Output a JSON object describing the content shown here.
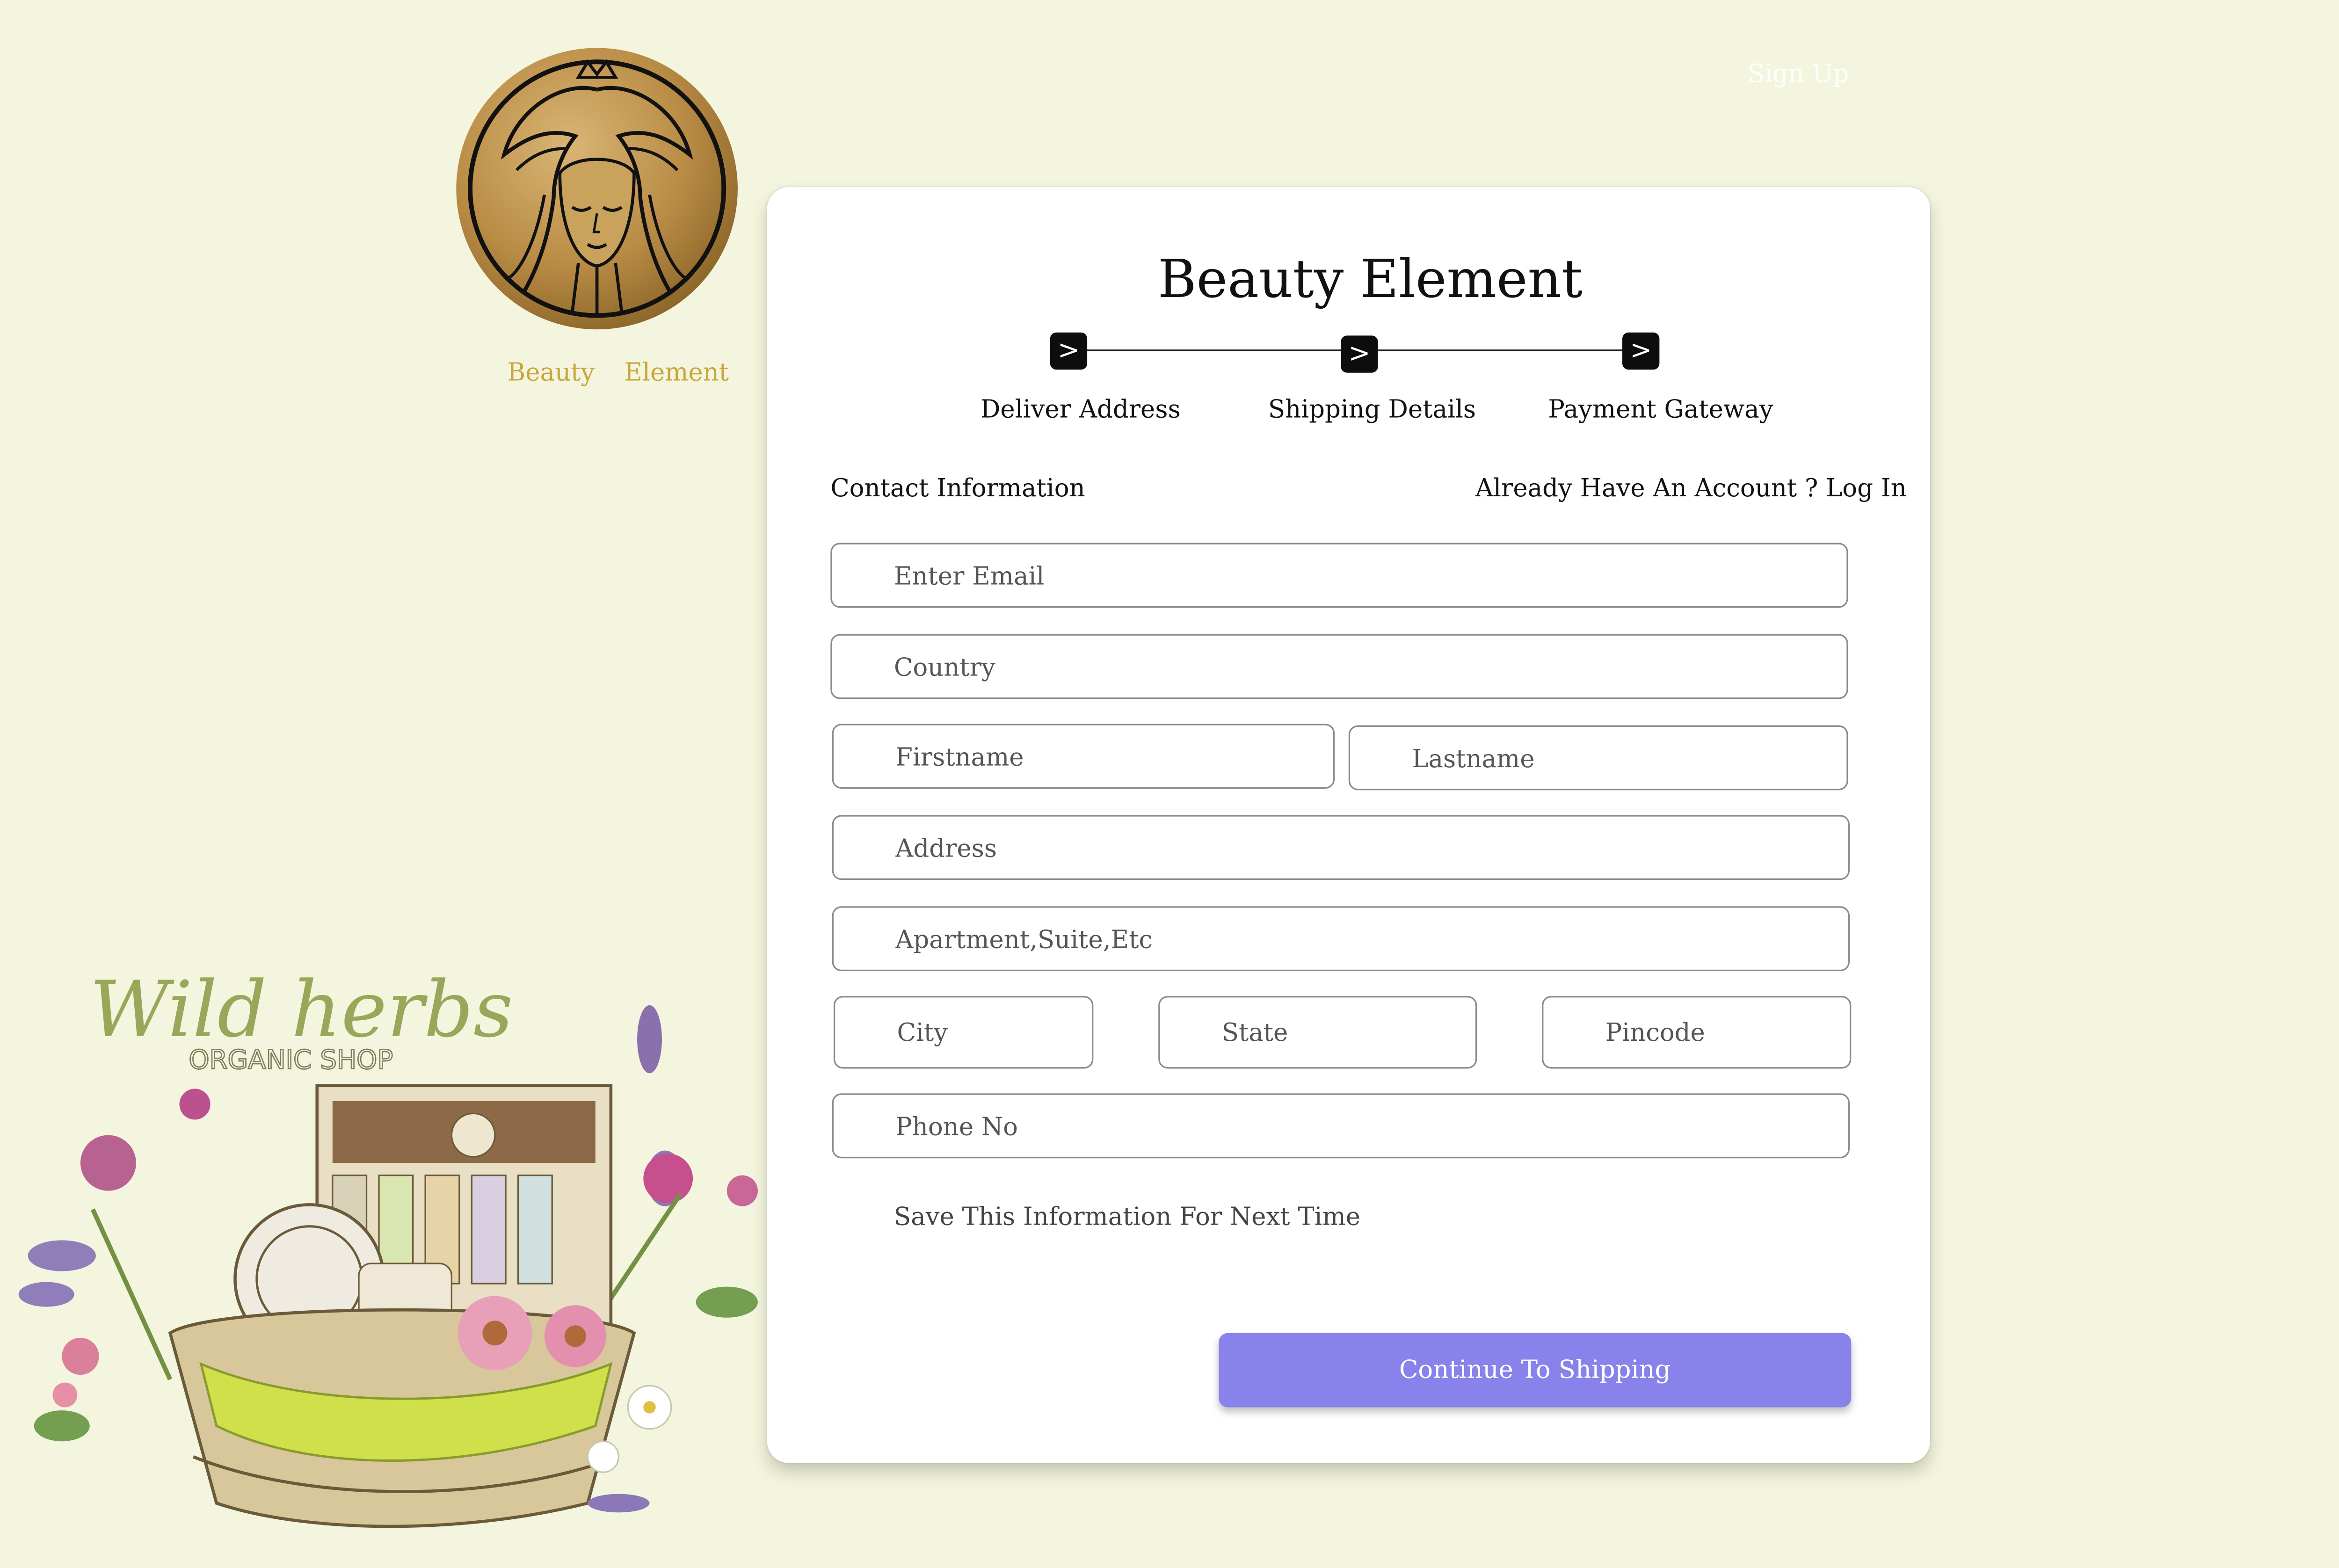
{
  "brand": {
    "word1": "Beauty",
    "word2": "Element",
    "logo_icon": "goddess-medallion-icon",
    "gold": "#c9a63c"
  },
  "header": {
    "signup_label": "Sign Up"
  },
  "card": {
    "title": "Beauty Element",
    "steps": [
      {
        "label": "Deliver Address",
        "icon": ">"
      },
      {
        "label": "Shipping Details",
        "icon": ">"
      },
      {
        "label": "Payment Gateway",
        "icon": ">"
      }
    ],
    "contact_label": "Contact Information",
    "login_prompt": "Already Have An Account ? Log In",
    "fields": {
      "email": "Enter Email",
      "country": "Country",
      "firstname": "Firstname",
      "lastname": "Lastname",
      "address": "Address",
      "apartment": "Apartment,Suite,Etc",
      "city": "City",
      "state": "State",
      "pincode": "Pincode",
      "phone": "Phone No"
    },
    "save_label": "Save This Information For Next Time",
    "continue_label": "Continue To Shipping",
    "accent": "#8882ea"
  },
  "illustration": {
    "title": "Wild herbs",
    "subtitle": "ORGANIC SHOP",
    "icon": "herb-basket-illustration"
  }
}
